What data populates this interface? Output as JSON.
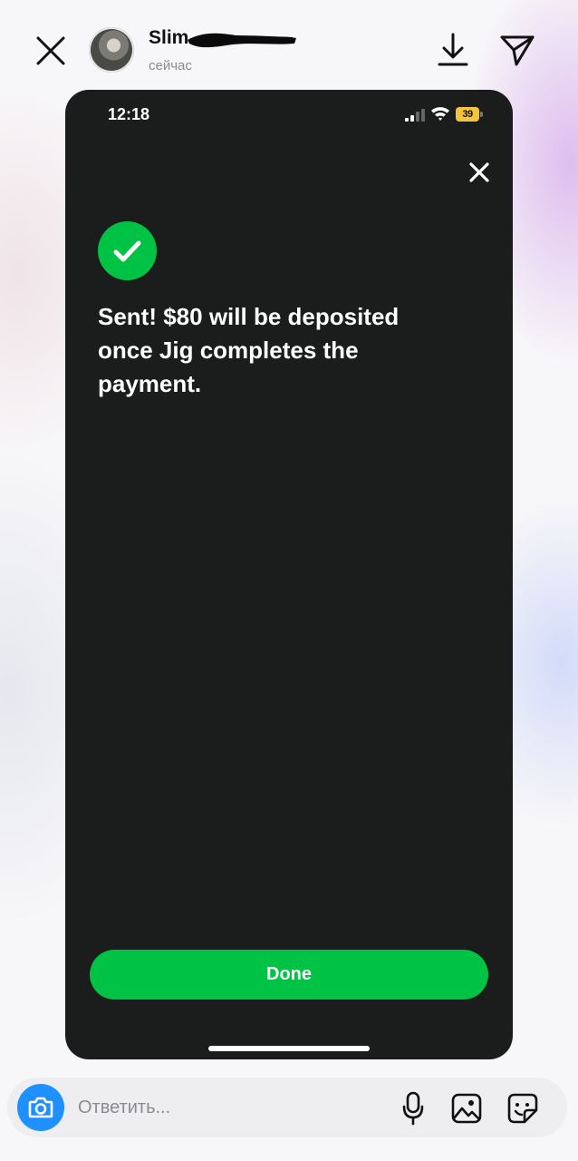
{
  "story_header": {
    "username": "Slim",
    "timestamp": "сейчас",
    "close_icon": "close-icon",
    "download_icon": "download-icon",
    "share_icon": "send-icon"
  },
  "screenshot": {
    "status_bar": {
      "time": "12:18",
      "battery_percent": "39"
    },
    "message": "Sent! $80 will be deposited once Jig completes the payment.",
    "done_label": "Done",
    "colors": {
      "background": "#1b1c1c",
      "accent_green": "#00c244",
      "battery": "#f2c53d"
    }
  },
  "reply_bar": {
    "placeholder": "Ответить...",
    "camera_color": "#1e90ff",
    "icons": [
      "camera-icon",
      "microphone-icon",
      "gallery-icon",
      "sticker-icon"
    ]
  }
}
